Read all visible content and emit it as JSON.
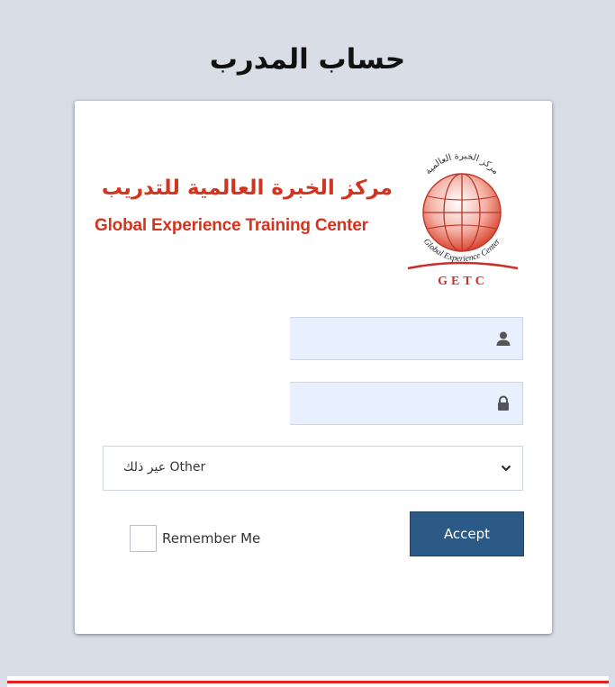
{
  "page": {
    "title": "حساب المدرب"
  },
  "logo": {
    "arabic_name": "مركز الخبرة العالمية للتدريب",
    "english_name": "Global Experience Training Center",
    "globe_arc_top": "مركز الخبرة العالمية",
    "globe_arc_bottom": "Global Experience Center",
    "acronym": "GETC",
    "brand_color": "#d2341f"
  },
  "form": {
    "username": {
      "value": "",
      "icon": "user-icon"
    },
    "password": {
      "value": "",
      "icon": "lock-icon"
    },
    "role_select": {
      "selected": "عير ذلك Other",
      "icon": "chevron-down-icon"
    },
    "remember_me": {
      "label": "Remember Me",
      "checked": false
    },
    "accept_label": "Accept",
    "accept_color": "#2b5a86"
  },
  "colors": {
    "background": "#d9dde6",
    "accent_line": "#e5221f"
  }
}
